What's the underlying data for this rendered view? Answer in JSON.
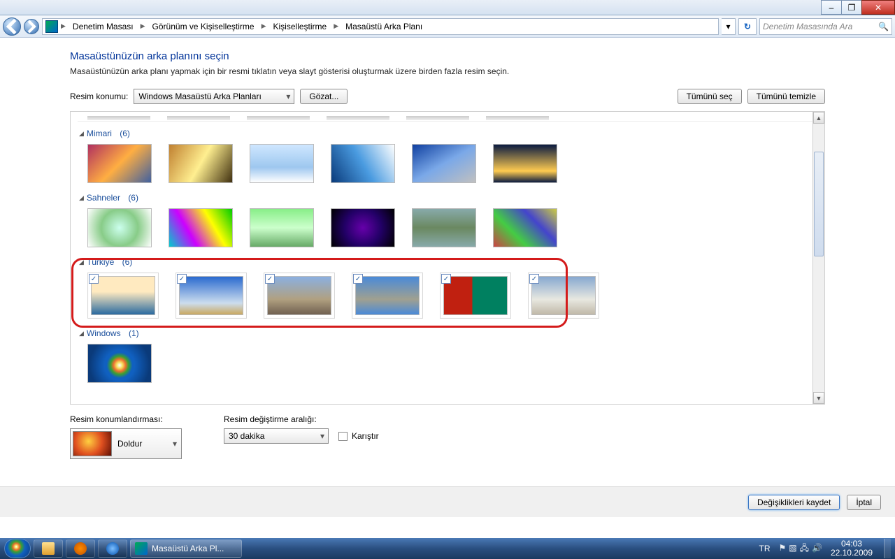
{
  "window_controls": {
    "minimize": "–",
    "maximize": "❐",
    "close": "✕"
  },
  "breadcrumb": {
    "items": [
      "Denetim Masası",
      "Görünüm ve Kişiselleştirme",
      "Kişiselleştirme",
      "Masaüstü Arka Planı"
    ]
  },
  "search": {
    "placeholder": "Denetim Masasında Ara"
  },
  "page": {
    "title": "Masaüstünüzün arka planını seçin",
    "desc": "Masaüstünüzün arka planı yapmak için bir resmi tıklatın veya slayt gösterisi oluşturmak üzere birden fazla resim seçin."
  },
  "toolbar": {
    "location_label": "Resim konumu:",
    "location_value": "Windows Masaüstü Arka Planları",
    "browse": "Gözat...",
    "select_all": "Tümünü seç",
    "clear_all": "Tümünü temizle"
  },
  "groups": {
    "g0": {
      "title": "Mimari",
      "count": "(6)"
    },
    "g1": {
      "title": "Sahneler",
      "count": "(6)"
    },
    "g2": {
      "title": "Türkiye",
      "count": "(6)"
    },
    "g3": {
      "title": "Windows",
      "count": "(1)"
    }
  },
  "lower": {
    "position_label": "Resim konumlandırması:",
    "position_value": "Doldur",
    "interval_label": "Resim değiştirme aralığı:",
    "interval_value": "30 dakika",
    "shuffle": "Karıştır"
  },
  "footer": {
    "save": "Değişiklikleri kaydet",
    "cancel": "İptal"
  },
  "taskbar": {
    "active_title": "Masaüstü Arka Pl...",
    "lang": "TR",
    "time": "04:03",
    "date": "22.10.2009"
  }
}
